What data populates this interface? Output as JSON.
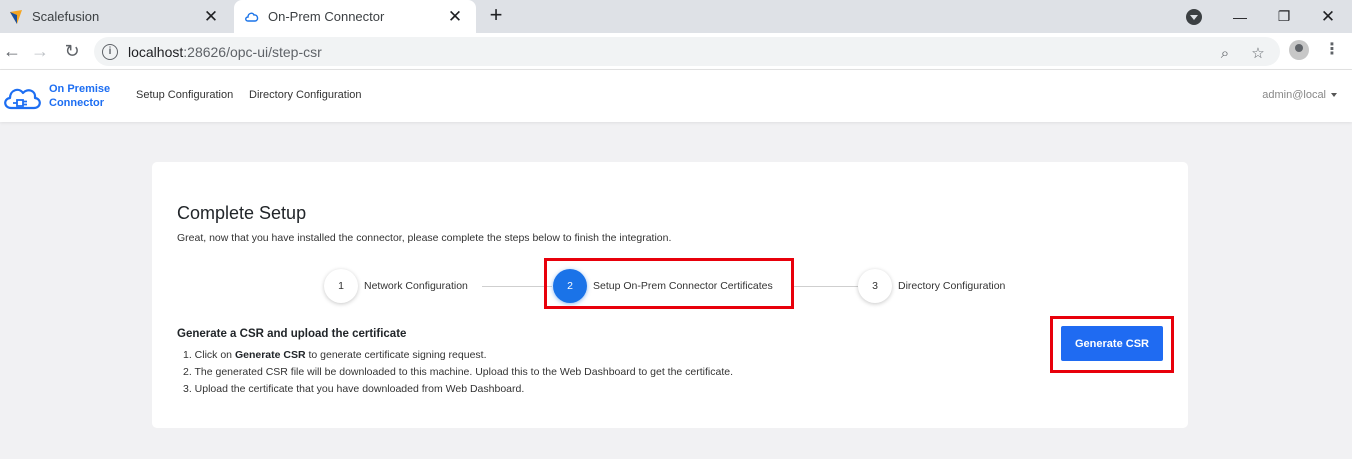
{
  "browser": {
    "tabs": [
      {
        "title": "Scalefusion",
        "active": false
      },
      {
        "title": "On-Prem Connector",
        "active": true
      }
    ],
    "url_host": "localhost",
    "url_path": ":28626/opc-ui/step-csr"
  },
  "app": {
    "brand_line1": "On Premise",
    "brand_line2": "Connector",
    "nav": [
      "Setup Configuration",
      "Directory Configuration"
    ],
    "user": "admin@local"
  },
  "setup": {
    "title": "Complete Setup",
    "subtitle": "Great, now that you have installed the connector, please complete the steps below to finish the integration.",
    "steps": [
      {
        "number": "1",
        "label": "Network Configuration",
        "active": false
      },
      {
        "number": "2",
        "label": "Setup On-Prem Connector Certificates",
        "active": true
      },
      {
        "number": "3",
        "label": "Directory Configuration",
        "active": false
      }
    ],
    "section_heading": "Generate a CSR and upload the certificate",
    "instructions": {
      "i1_prefix": "1. Click on ",
      "i1_bold": "Generate CSR",
      "i1_suffix": " to generate certificate signing request.",
      "i2": "2. The generated CSR file will be downloaded to this machine. Upload this to the Web Dashboard to get the certificate.",
      "i3": "3. Upload the certificate that you have downloaded from Web Dashboard."
    },
    "button_label": "Generate CSR"
  },
  "colors": {
    "accent": "#1a73e8",
    "button": "#1f6bf2",
    "highlight": "#e8000b",
    "page_bg": "#f1f1f3"
  },
  "icons": [
    "scalefusion-favicon",
    "cloud-favicon",
    "close-icon",
    "plus-icon",
    "profile-icon",
    "minimize-icon",
    "restore-icon",
    "back-arrow-icon",
    "forward-arrow-icon",
    "reload-icon",
    "info-icon",
    "zoom-icon",
    "star-icon",
    "avatar-icon",
    "kebab-menu-icon",
    "cloud-plug-logo",
    "caret-down-icon"
  ]
}
